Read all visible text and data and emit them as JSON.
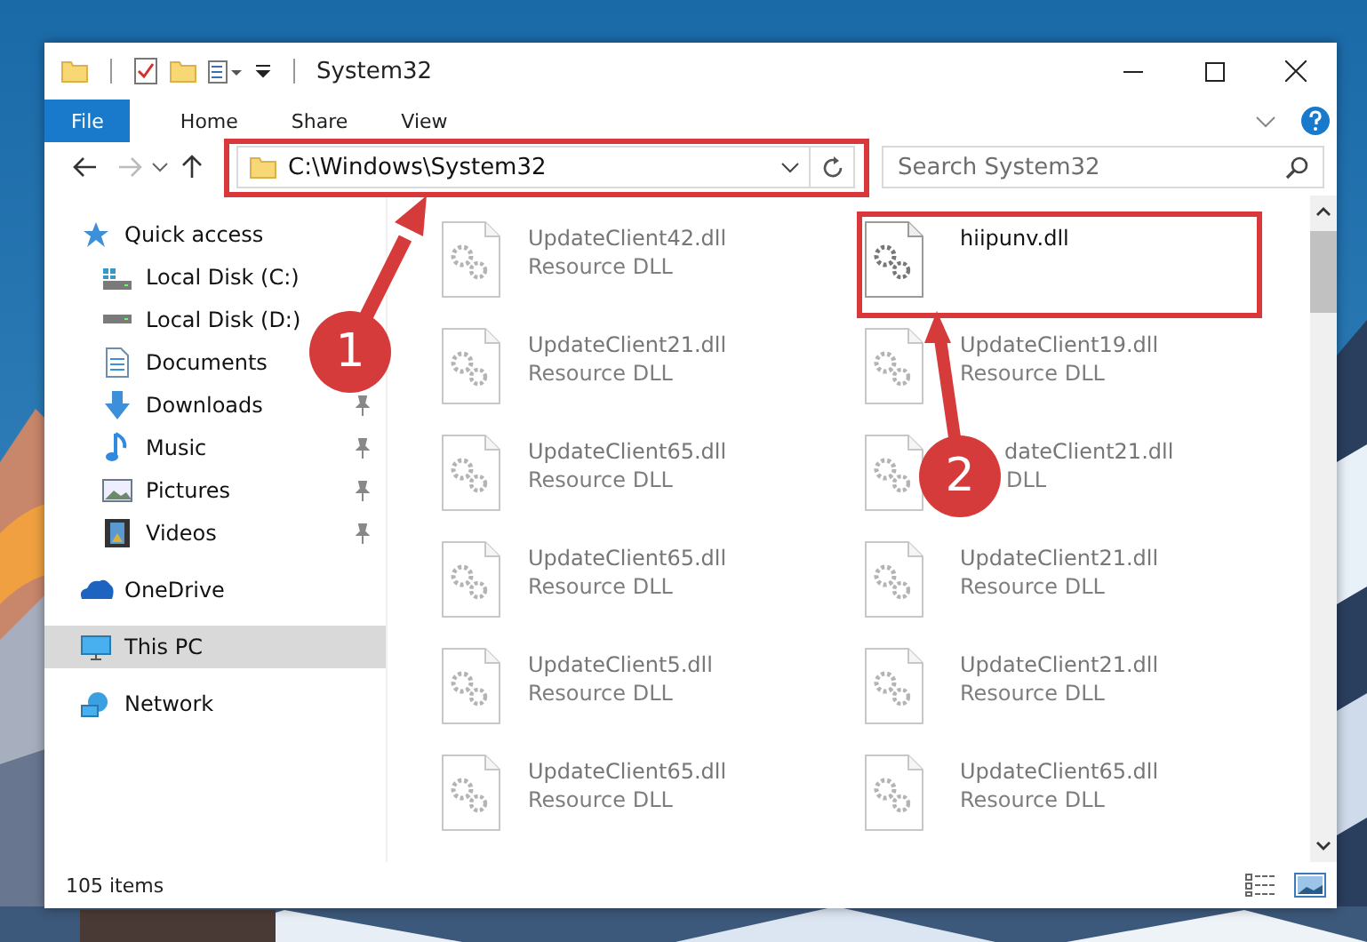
{
  "window": {
    "title": "System32"
  },
  "ribbon_tabs": [
    {
      "label": "File",
      "selected": true
    },
    {
      "label": "Home",
      "selected": false
    },
    {
      "label": "Share",
      "selected": false
    },
    {
      "label": "View",
      "selected": false
    }
  ],
  "address": {
    "value": "C:\\Windows\\System32"
  },
  "search": {
    "placeholder": "Search System32"
  },
  "sidebar": {
    "items": [
      {
        "label": "Quick access",
        "kind": "star",
        "selected": false,
        "children": [
          {
            "label": "Local Disk (C:)",
            "kind": "system-drive",
            "selected": false
          },
          {
            "label": "Local Disk (D:)",
            "kind": "drive",
            "selected": false
          },
          {
            "label": "Documents",
            "kind": "documents",
            "selected": false
          },
          {
            "label": "Downloads",
            "kind": "downloads",
            "pinned": true,
            "selected": false
          },
          {
            "label": "Music",
            "kind": "music",
            "pinned": true,
            "selected": false
          },
          {
            "label": "Pictures",
            "kind": "pictures",
            "pinned": true,
            "selected": false
          },
          {
            "label": "Videos",
            "kind": "videos",
            "pinned": true,
            "selected": false
          }
        ]
      },
      {
        "label": "OneDrive",
        "kind": "cloud",
        "selected": false
      },
      {
        "label": "This PC",
        "kind": "pc",
        "selected": true
      },
      {
        "label": "Network",
        "kind": "network",
        "selected": false
      }
    ]
  },
  "files": [
    {
      "kind": "file",
      "name": "UpdateClient42.dll",
      "type": "Resource DLL",
      "blurred": true
    },
    {
      "kind": "file",
      "name": "hiipunv.dll",
      "blurred": false
    },
    {
      "kind": "file",
      "name": "UpdateClient21.dll",
      "type": "Resource DLL",
      "blurred": true
    },
    {
      "kind": "file",
      "name": "UpdateClient19.dll",
      "type": "Resource DLL",
      "blurred": true
    },
    {
      "kind": "file",
      "name": "UpdateClient65.dll",
      "type": "Resource DLL",
      "blurred": true
    },
    {
      "kind": "covered",
      "name": "dateClient21.dll",
      "type": "DLL",
      "blurred": true
    },
    {
      "kind": "file",
      "name": "UpdateClient65.dll",
      "type": "Resource DLL",
      "blurred": true
    },
    {
      "kind": "file",
      "name": "UpdateClient21.dll",
      "type": "Resource DLL",
      "blurred": true
    },
    {
      "kind": "file",
      "name": "UpdateClient5.dll",
      "type": "Resource DLL",
      "blurred": true
    },
    {
      "kind": "file",
      "name": "UpdateClient21.dll",
      "type": "Resource DLL",
      "blurred": true
    },
    {
      "kind": "file",
      "name": "UpdateClient65.dll",
      "type": "Resource DLL",
      "blurred": true
    },
    {
      "kind": "file",
      "name": "UpdateClient65.dll",
      "type": "Resource DLL",
      "blurred": true
    }
  ],
  "status_bar": {
    "item_count": "105 items"
  },
  "annotations": [
    {
      "number": "1"
    },
    {
      "number": "2"
    }
  ]
}
